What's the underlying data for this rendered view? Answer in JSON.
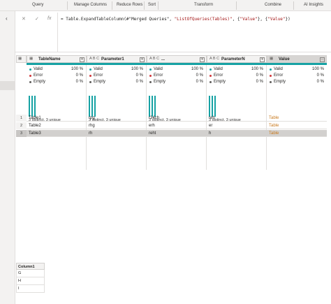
{
  "ribbon": {
    "groups": [
      "Query",
      "Manage Columns",
      "Reduce Rows",
      "Sort",
      "Transform",
      "Combine",
      "AI Insights"
    ]
  },
  "formula_bar": {
    "cancel_icon": "close-icon",
    "confirm_icon": "check-icon",
    "fx_label": "fx",
    "prefix": "= Table.ExpandTableColumn(#\"Merged Queries\", ",
    "arg2": "\"ListOfQueries(Tables)\"",
    "mid": ", {",
    "arg3": "\"Value\"",
    "mid2": "}, {",
    "arg4": "\"Value\"",
    "suffix": "})"
  },
  "columns": [
    {
      "type": "▦",
      "name": "TableName"
    },
    {
      "type": "A B C",
      "name": "Parameter1"
    },
    {
      "type": "A B C",
      "name": "..."
    },
    {
      "type": "A B C",
      "name": "ParameterN"
    },
    {
      "type": "▦",
      "name": "Value"
    }
  ],
  "profile": {
    "valid_label": "Valid",
    "error_label": "Error",
    "empty_label": "Empty",
    "valid_pct": "100 %",
    "error_pct": "0 %",
    "empty_pct": "0 %",
    "distinct": "3 distinct, 3 unique",
    "colors": {
      "valid": "#17a2a4",
      "error": "#d13438",
      "empty": "#605e5c"
    }
  },
  "rows": [
    {
      "num": "1",
      "cells": [
        "Table1",
        "rpg",
        "r34ch",
        "reh",
        "Table"
      ]
    },
    {
      "num": "2",
      "cells": [
        "Table2",
        "rhg",
        "erh",
        "er",
        "Table"
      ]
    },
    {
      "num": "3",
      "cells": [
        "Table3",
        "rh",
        "reht",
        "h",
        "Table"
      ]
    }
  ],
  "mini_table": {
    "header": "Column1",
    "rows": [
      "G",
      "H",
      "I"
    ]
  }
}
